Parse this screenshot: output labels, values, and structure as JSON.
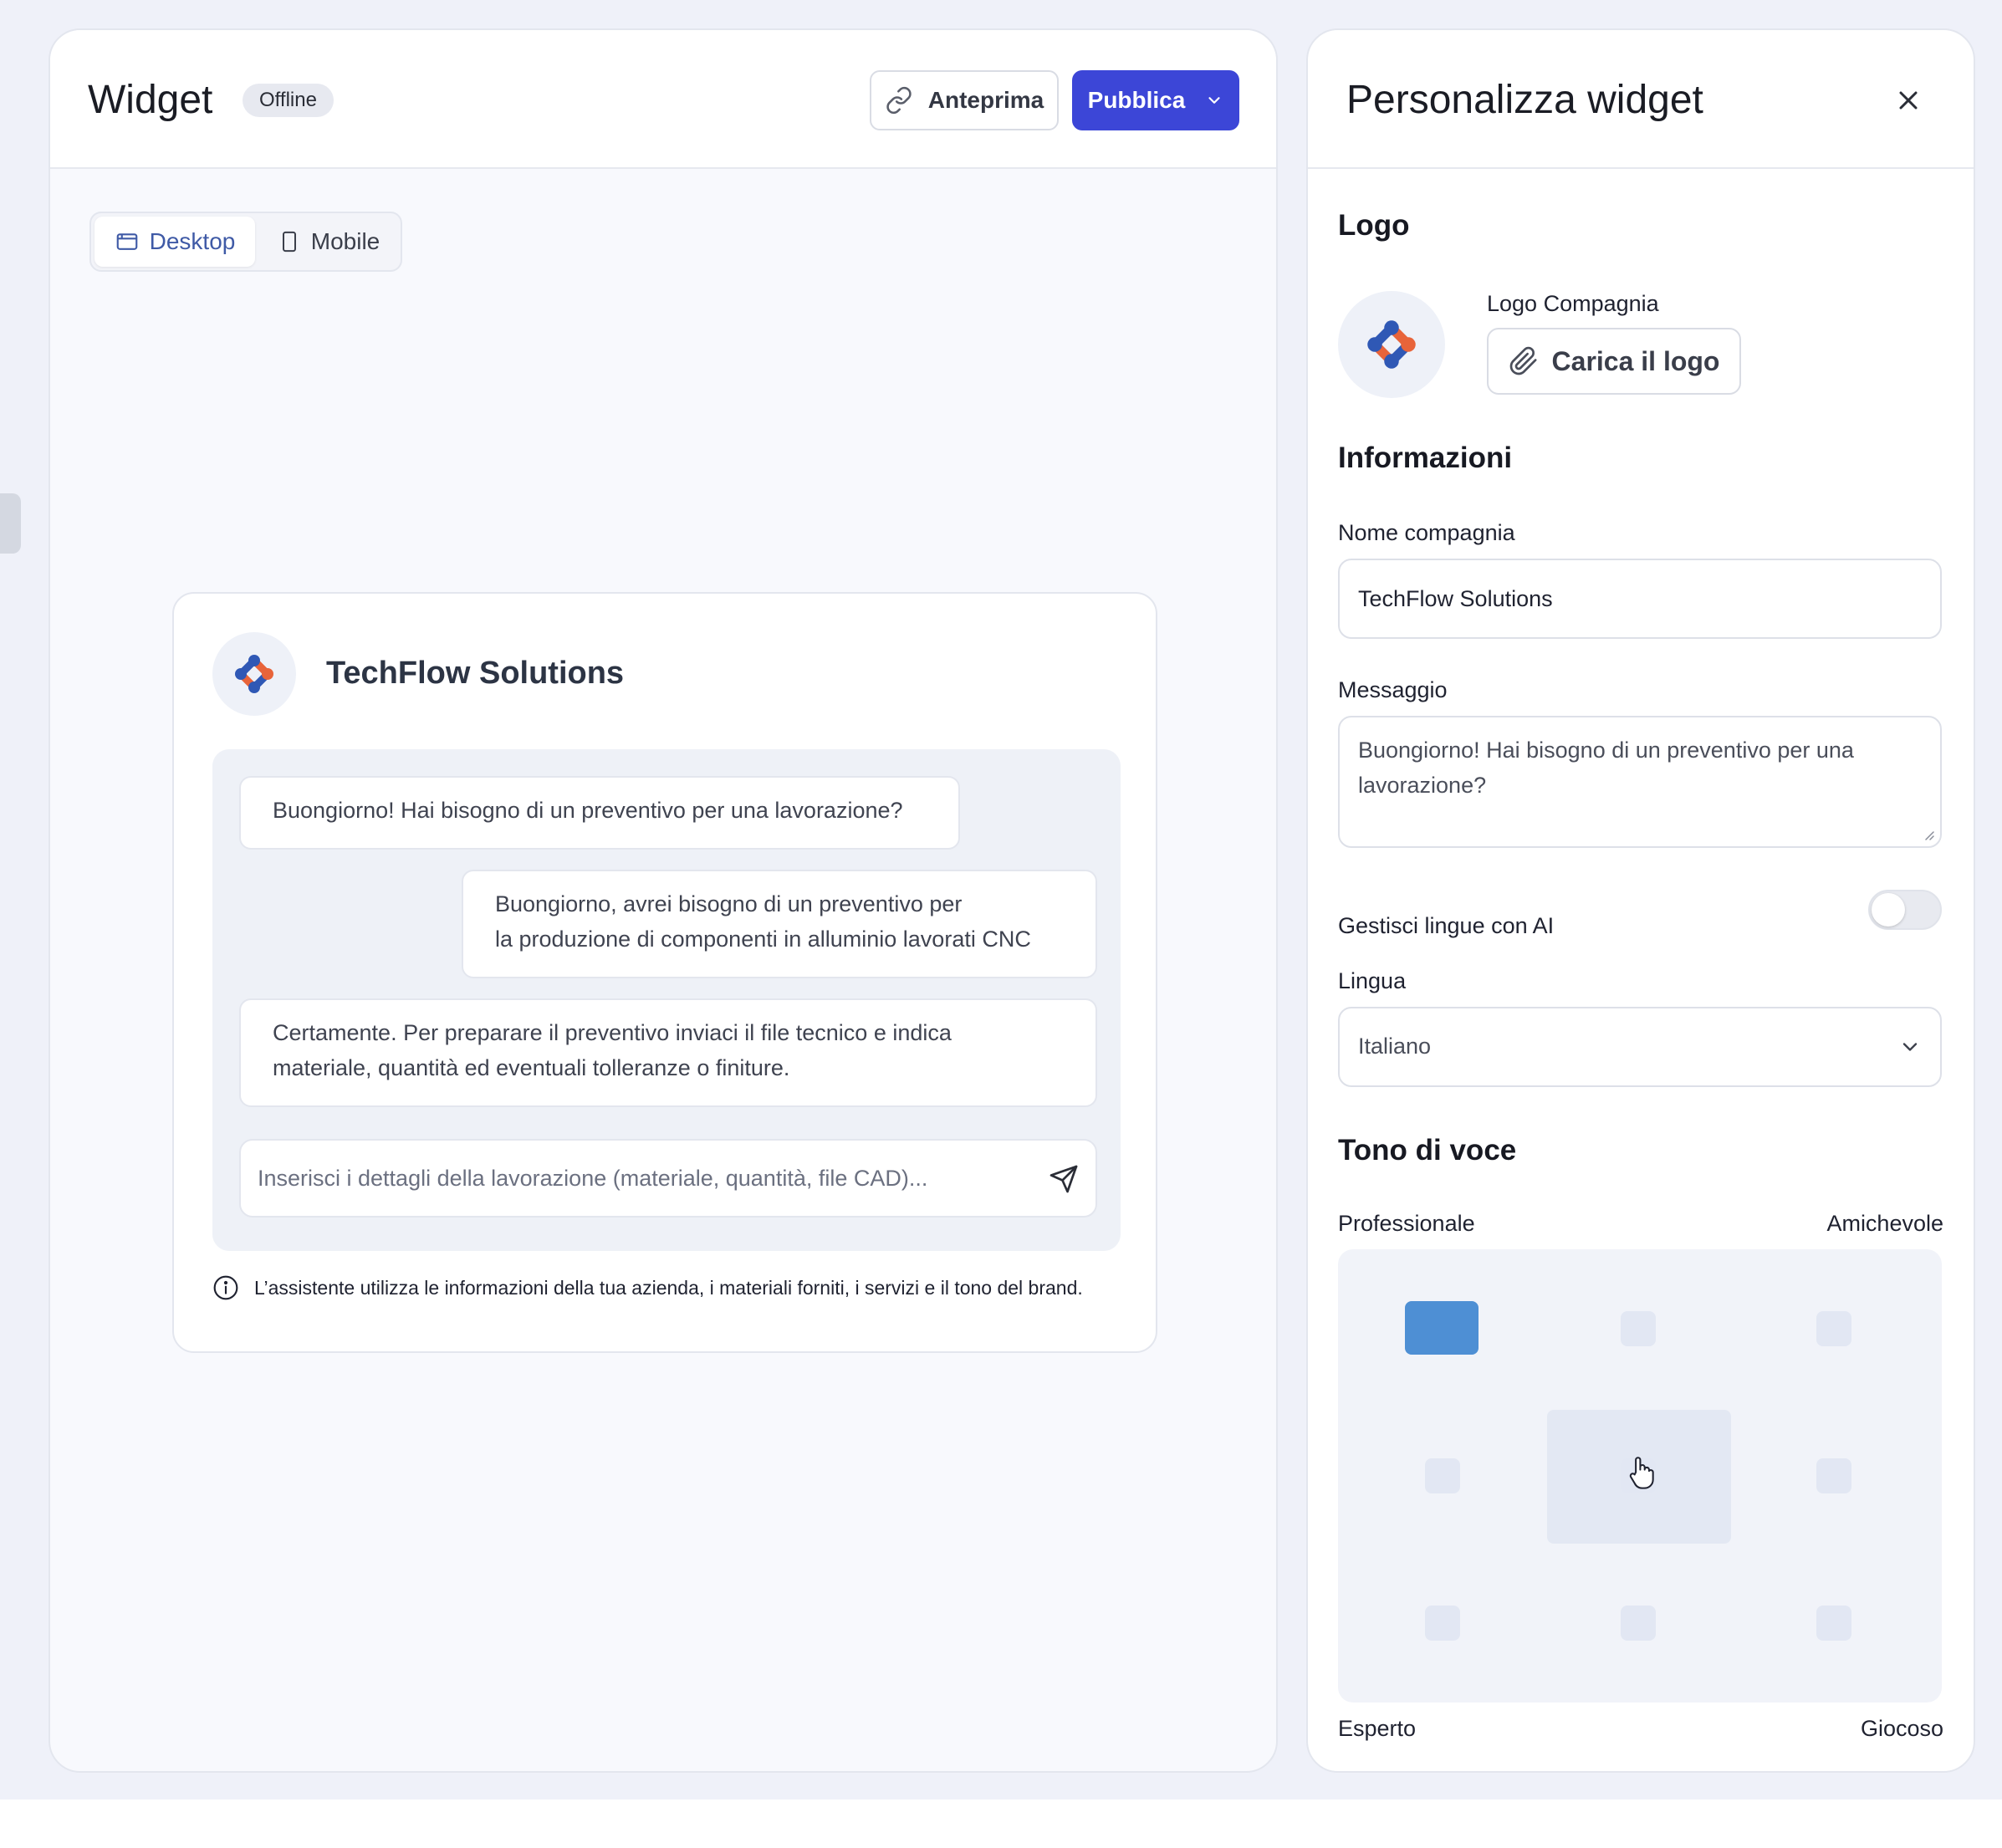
{
  "main": {
    "title": "Widget",
    "status": "Offline",
    "preview_label": "Anteprima",
    "publish_label": "Pubblica",
    "device_tabs": [
      {
        "label": "Desktop",
        "icon": "calendar-window-icon",
        "active": true
      },
      {
        "label": "Mobile",
        "icon": "phone-icon",
        "active": false
      }
    ]
  },
  "chat": {
    "company_name": "TechFlow Solutions",
    "messages": [
      {
        "from": "bot",
        "lines": [
          "Buongiorno! Hai bisogno di un preventivo per una lavorazione?"
        ]
      },
      {
        "from": "user",
        "lines": [
          "Buongiorno, avrei bisogno di un preventivo per",
          "la produzione di componenti in alluminio lavorati CNC"
        ]
      },
      {
        "from": "bot",
        "lines": [
          "Certamente. Per preparare il preventivo inviaci il file tecnico e indica",
          "materiale, quantità ed eventuali tolleranze o finiture."
        ]
      }
    ],
    "input_placeholder": "Inserisci i dettagli della lavorazione (materiale, quantità, file CAD)...",
    "note": "L’assistente utilizza le informazioni della tua azienda, i materiali forniti, i servizi e il tono del brand."
  },
  "panel": {
    "title": "Personalizza widget",
    "logo_section": "Logo",
    "logo_label": "Logo Compagnia",
    "upload_label": "Carica il logo",
    "info_section": "Informazioni",
    "company_label": "Nome compagnia",
    "company_value": "TechFlow Solutions",
    "message_label": "Messaggio",
    "message_value": "Buongiorno! Hai bisogno di un preventivo per una lavorazione?",
    "ai_lang_label": "Gestisci lingue con AI",
    "ai_lang_enabled": false,
    "language_label": "Lingua",
    "language_value": "Italiano",
    "tone_section": "Tono di voce",
    "tone_axes": {
      "top_left": "Professionale",
      "top_right": "Amichevole",
      "bottom_left": "Esperto",
      "bottom_right": "Giocoso"
    },
    "tone_selected": {
      "row": 0,
      "col": 0
    }
  },
  "colors": {
    "primary": "#3c46d7",
    "selected_tone": "#4e8fd4",
    "logo_blue": "#2f58b5",
    "logo_orange": "#e8643a"
  }
}
